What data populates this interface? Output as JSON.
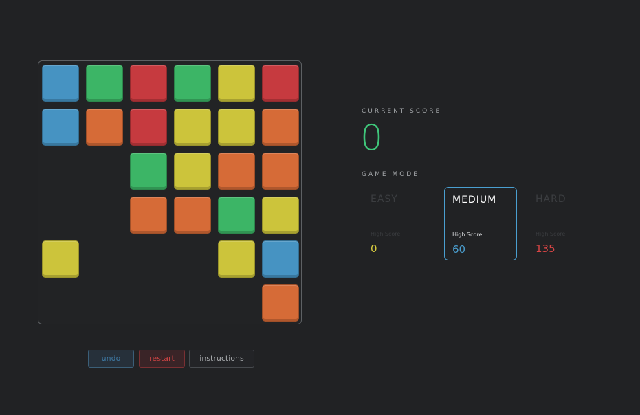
{
  "board": {
    "columns": 6,
    "rows": 6,
    "tiles": [
      {
        "row": 0,
        "col": 0,
        "color": "blue"
      },
      {
        "row": 0,
        "col": 1,
        "color": "green"
      },
      {
        "row": 0,
        "col": 2,
        "color": "red"
      },
      {
        "row": 0,
        "col": 3,
        "color": "green"
      },
      {
        "row": 0,
        "col": 4,
        "color": "yellow"
      },
      {
        "row": 0,
        "col": 5,
        "color": "red"
      },
      {
        "row": 1,
        "col": 0,
        "color": "blue"
      },
      {
        "row": 1,
        "col": 1,
        "color": "orange"
      },
      {
        "row": 1,
        "col": 2,
        "color": "red"
      },
      {
        "row": 1,
        "col": 3,
        "color": "yellow"
      },
      {
        "row": 1,
        "col": 4,
        "color": "yellow"
      },
      {
        "row": 1,
        "col": 5,
        "color": "orange"
      },
      {
        "row": 2,
        "col": 2,
        "color": "green"
      },
      {
        "row": 2,
        "col": 3,
        "color": "yellow"
      },
      {
        "row": 2,
        "col": 4,
        "color": "orange"
      },
      {
        "row": 2,
        "col": 5,
        "color": "orange"
      },
      {
        "row": 3,
        "col": 2,
        "color": "orange"
      },
      {
        "row": 3,
        "col": 3,
        "color": "orange"
      },
      {
        "row": 3,
        "col": 4,
        "color": "green"
      },
      {
        "row": 3,
        "col": 5,
        "color": "yellow"
      },
      {
        "row": 4,
        "col": 0,
        "color": "yellow"
      },
      {
        "row": 4,
        "col": 4,
        "color": "yellow"
      },
      {
        "row": 4,
        "col": 5,
        "color": "blue"
      },
      {
        "row": 5,
        "col": 5,
        "color": "orange"
      }
    ]
  },
  "controls": {
    "undo_label": "undo",
    "restart_label": "restart",
    "instructions_label": "instructions"
  },
  "score": {
    "label": "CURRENT SCORE",
    "value": "0"
  },
  "game_mode": {
    "label": "GAME MODE",
    "selected": "MEDIUM",
    "modes": [
      {
        "name": "EASY",
        "high_score_label": "High Score",
        "high_score": "0"
      },
      {
        "name": "MEDIUM",
        "high_score_label": "High Score",
        "high_score": "60"
      },
      {
        "name": "HARD",
        "high_score_label": "High Score",
        "high_score": "135"
      }
    ]
  },
  "colors": {
    "blue": "#4693c2",
    "green": "#3cb566",
    "red": "#c63a3f",
    "yellow": "#ccc43b",
    "orange": "#d66b37",
    "score": "#3fc67a",
    "selected_border": "#4a9fd0"
  }
}
